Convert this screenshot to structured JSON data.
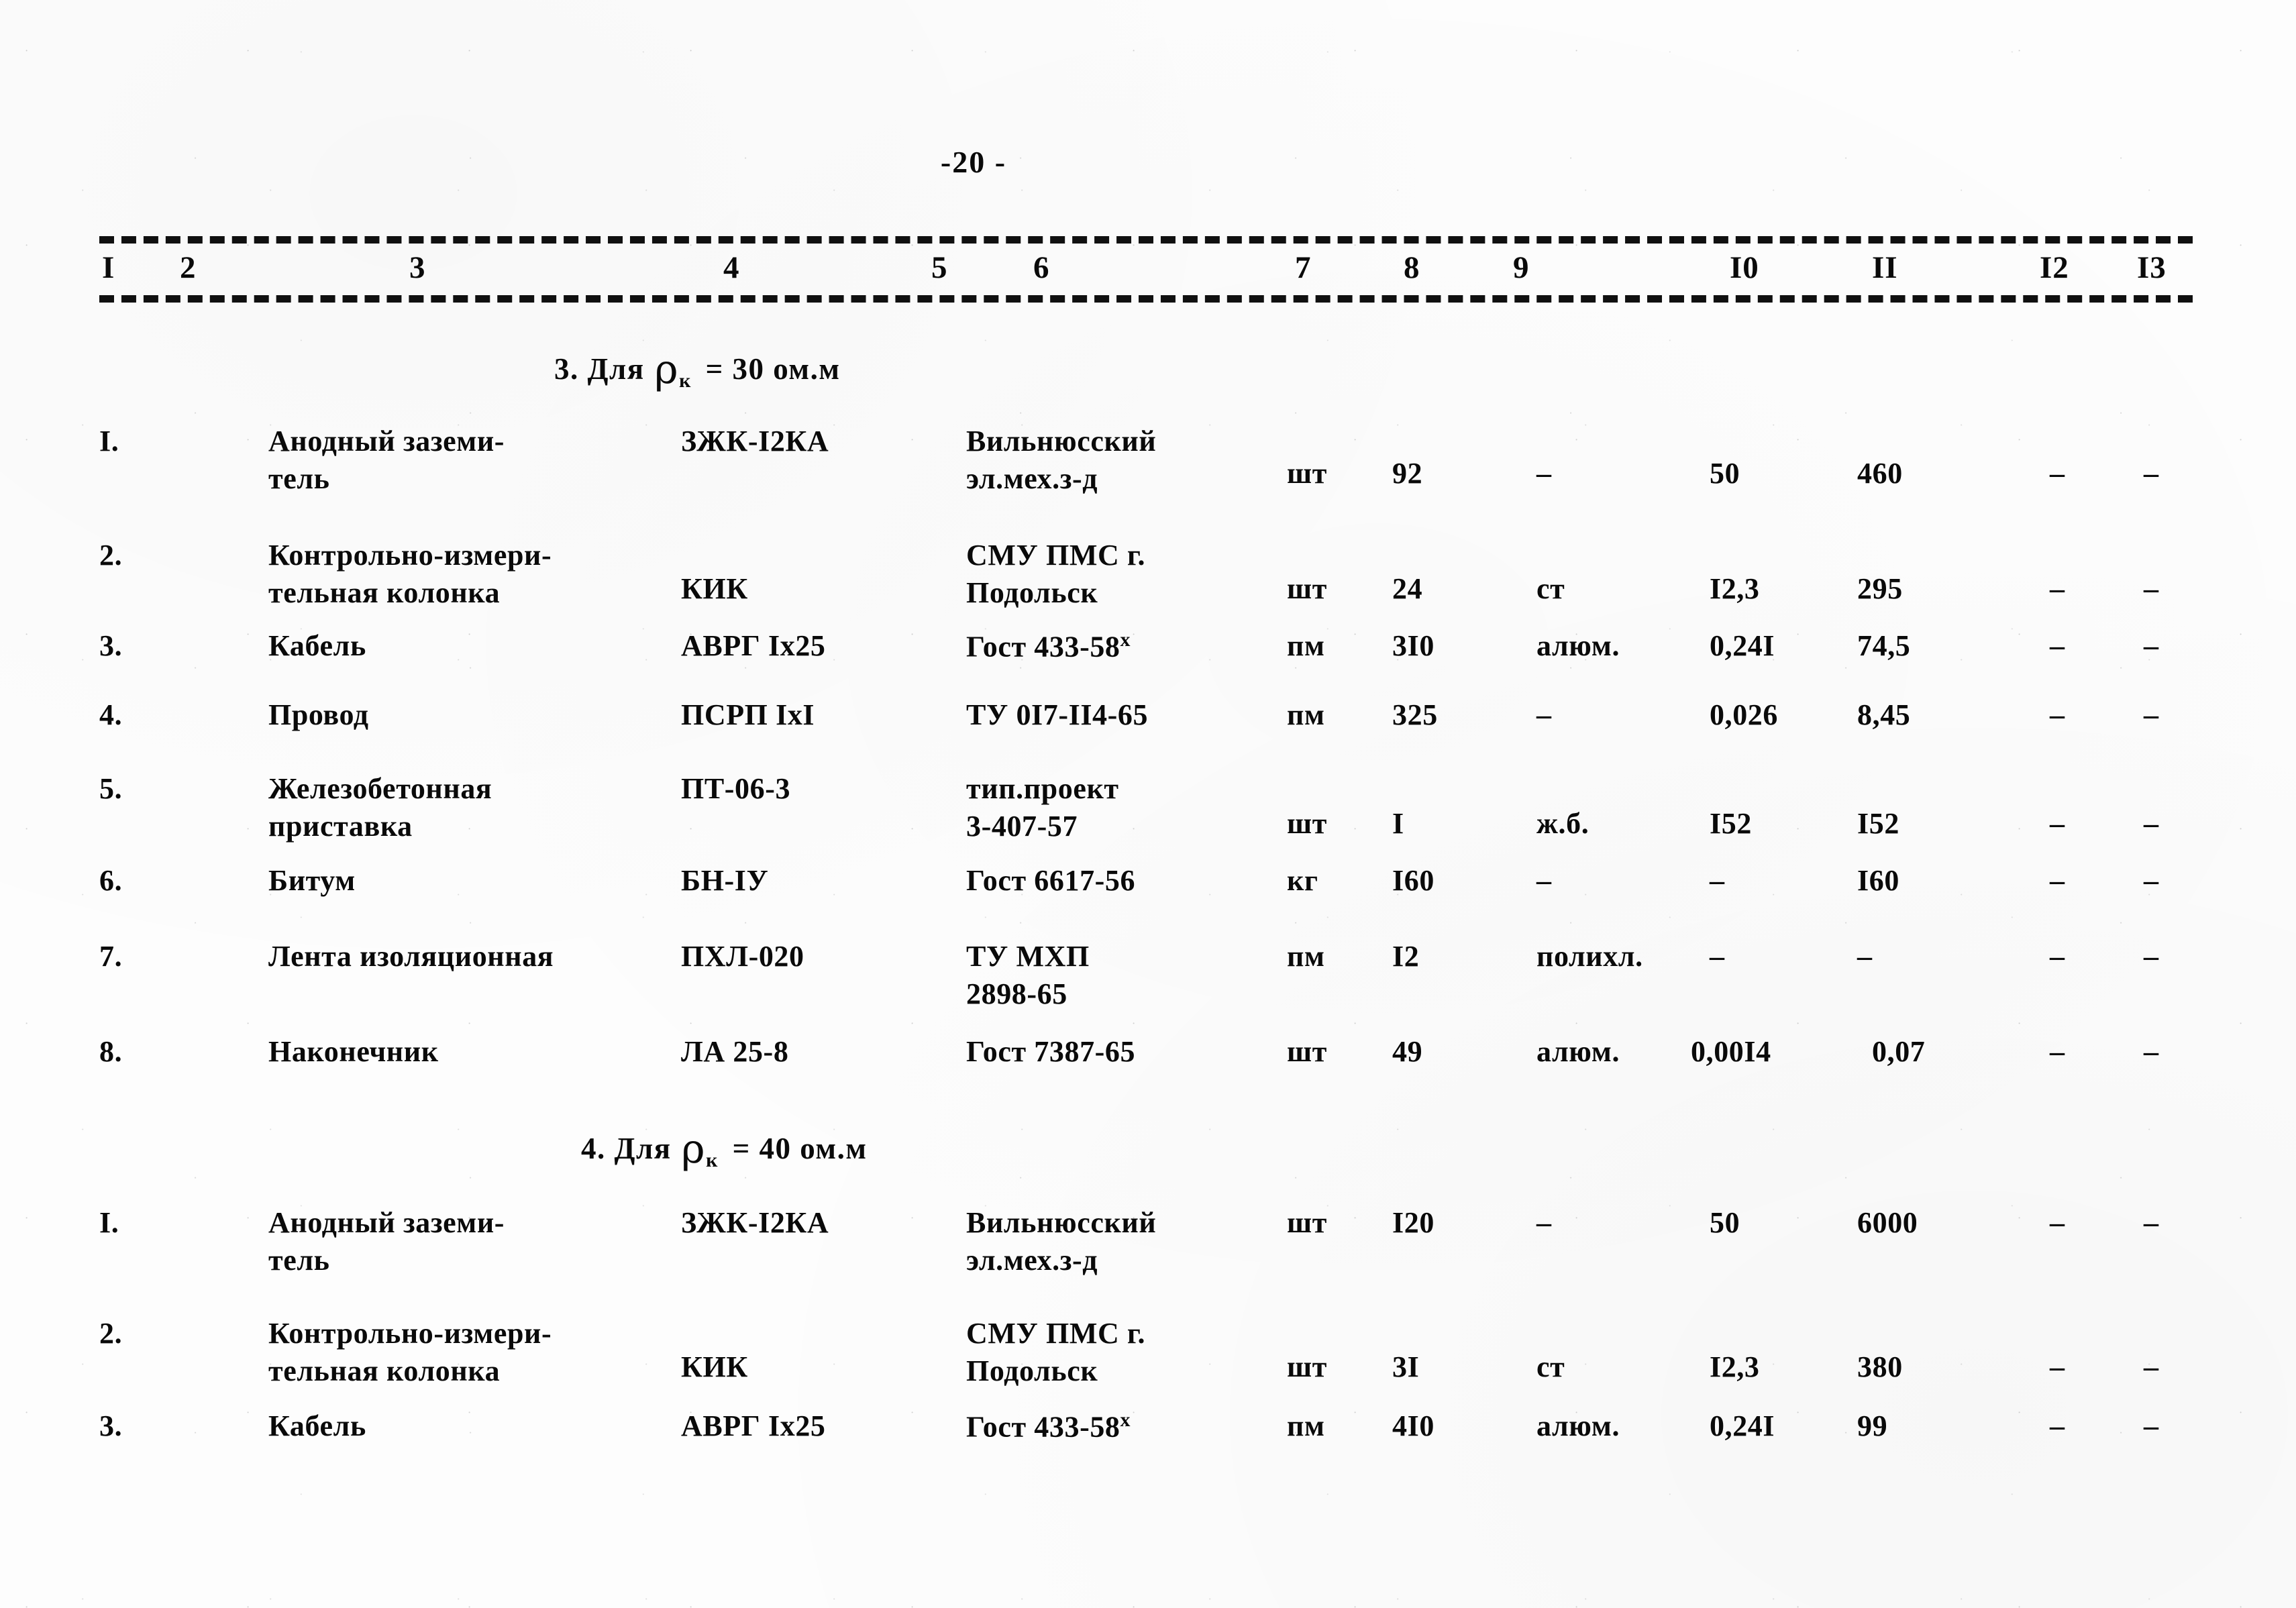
{
  "document": {
    "page_number": "-20 -",
    "type": "specification-table"
  },
  "table": {
    "column_headers": [
      "I",
      "2",
      "3",
      "4",
      "5",
      "6",
      "7",
      "8",
      "9",
      "I0",
      "II",
      "I2",
      "I3"
    ],
    "sections": [
      {
        "heading_number": "3.",
        "heading_prefix": "Для",
        "heading_symbol": "ρ",
        "heading_subscript": "к",
        "heading_suffix": "= 30 ом.м",
        "heading_full": "3. Для ρк = 30 ом.м",
        "rows": [
          {
            "num": "I.",
            "name": "Анодный заземи-\nтель",
            "type": "ЗЖК-I2КА",
            "standard": "Вильнюсский\nэл.мех.з-д",
            "unit": "шт",
            "qty": "92",
            "material": "–",
            "unit_weight": "50",
            "total_weight": "460",
            "col12": "–",
            "col13": "–"
          },
          {
            "num": "2.",
            "name": "Контрольно-измери-\nтельная колонка",
            "type": "КИК",
            "standard": "СМУ ПМС г.\nПодольск",
            "unit": "шт",
            "qty": "24",
            "material": "ст",
            "unit_weight": "I2,3",
            "total_weight": "295",
            "col12": "–",
            "col13": "–"
          },
          {
            "num": "3.",
            "name": "Кабель",
            "type": "АВРГ Iх25",
            "standard": "Гост 433-58",
            "standard_sup": "х",
            "unit": "пм",
            "qty": "3I0",
            "material": "алюм.",
            "unit_weight": "0,24I",
            "total_weight": "74,5",
            "col12": "–",
            "col13": "–"
          },
          {
            "num": "4.",
            "name": "Провод",
            "type": "ПСРП IхI",
            "standard": "ТУ 0I7-II4-65",
            "unit": "пм",
            "qty": "325",
            "material": "–",
            "unit_weight": "0,026",
            "total_weight": "8,45",
            "col12": "–",
            "col13": "–"
          },
          {
            "num": "5.",
            "name": "Железобетонная\nприставка",
            "type": "ПТ-06-3",
            "standard": "тип.проект\n3-407-57",
            "unit": "шт",
            "qty": "I",
            "material": "ж.б.",
            "unit_weight": "I52",
            "total_weight": "I52",
            "col12": "–",
            "col13": "–"
          },
          {
            "num": "6.",
            "name": "Битум",
            "type": "БН-IУ",
            "standard": "Гост 6617-56",
            "unit": "кг",
            "qty": "I60",
            "material": "–",
            "unit_weight": "–",
            "total_weight": "I60",
            "col12": "–",
            "col13": "–"
          },
          {
            "num": "7.",
            "name": "Лента изоляционная",
            "type": "ПХЛ-020",
            "standard": "ТУ МХП\n2898-65",
            "unit": "пм",
            "qty": "I2",
            "material": "полихл.",
            "unit_weight": "–",
            "total_weight": "–",
            "col12": "–",
            "col13": "–"
          },
          {
            "num": "8.",
            "name": "Наконечник",
            "type": "ЛА 25-8",
            "standard": "Гост 7387-65",
            "unit": "шт",
            "qty": "49",
            "material": "алюм.",
            "unit_weight": "0,00I4",
            "total_weight": "0,07",
            "col12": "–",
            "col13": "–"
          }
        ]
      },
      {
        "heading_number": "4.",
        "heading_prefix": "Для",
        "heading_symbol": "ρ",
        "heading_subscript": "к",
        "heading_suffix": "= 40 ом.м",
        "heading_full": "4. Для ρк = 40 ом.м",
        "rows": [
          {
            "num": "I.",
            "name": "Анодный заземи-\nтель",
            "type": "ЗЖК-I2КА",
            "standard": "Вильнюсский\nэл.мех.з-д",
            "unit": "шт",
            "qty": "I20",
            "material": "–",
            "unit_weight": "50",
            "total_weight": "6000",
            "col12": "–",
            "col13": "–"
          },
          {
            "num": "2.",
            "name": "Контрольно-измери-\nтельная колонка",
            "type": "КИК",
            "standard": "СМУ ПМС г.\nПодольск",
            "unit": "шт",
            "qty": "3I",
            "material": "ст",
            "unit_weight": "I2,3",
            "total_weight": "380",
            "col12": "–",
            "col13": "–"
          },
          {
            "num": "3.",
            "name": "Кабель",
            "type": "АВРГ Iх25",
            "standard": "Гост 433-58",
            "standard_sup": "х",
            "unit": "пм",
            "qty": "4I0",
            "material": "алюм.",
            "unit_weight": "0,24I",
            "total_weight": "99",
            "col12": "–",
            "col13": "–"
          }
        ]
      }
    ]
  }
}
